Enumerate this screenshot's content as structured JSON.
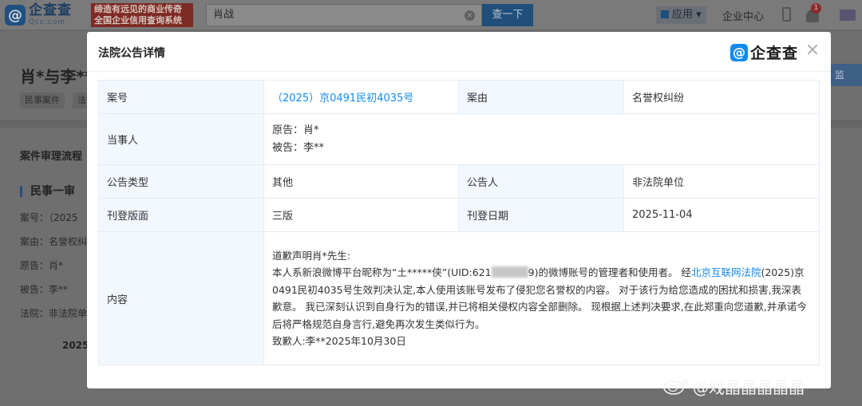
{
  "topbar": {
    "logo_mark": "@",
    "logo_cn": "企查查",
    "logo_en": "Qcc.com",
    "slogan_line1": "缔造有远见的商业传奇",
    "slogan_line2": "全国企业信用查询系统",
    "search_value": "肖战",
    "search_button": "查一下",
    "app_menu": "应用",
    "enterprise_center": "企业中心",
    "notification_count": "1"
  },
  "background": {
    "title": "肖*与李**",
    "tags": [
      "民事案件",
      "法"
    ],
    "monitor_label": "监",
    "section_title": "案件审理流程",
    "sub_title": "民事一审",
    "lines": [
      "案号：（2025",
      "案由：名誉权纠",
      "原告：肖*",
      "被告：李**",
      "法院：非法院单"
    ],
    "year": "2025"
  },
  "modal": {
    "title": "法院公告详情",
    "logo_mark": "@",
    "logo_text": "企查查",
    "close": "×",
    "rows": {
      "case_no_label": "案号",
      "case_no_value": "（2025）京0491民初4035号",
      "cause_label": "案由",
      "cause_value": "名誉权纠纷",
      "parties_label": "当事人",
      "plaintiff": "原告：肖*",
      "defendant": "被告：李**",
      "type_label": "公告类型",
      "type_value": "其他",
      "announcer_label": "公告人",
      "announcer_value": "非法院单位",
      "page_label": "刊登版面",
      "page_value": "三版",
      "date_label": "刊登日期",
      "date_value": "2025-11-04",
      "content_label": "内容"
    },
    "content": {
      "line1": "道歉声明肖*先生:",
      "line2_a": "本人系新浪微博平台昵称为“土*****侠”(UID:621",
      "line2_b": "9)的微博账号的管理者和使用者。 经",
      "court_link": "北京互联网法院",
      "line2_c": "(2025)京0491民初4035号生效判决认定,本人使用该账号发布了侵犯您名誉权的内容。 对于该行为给您造成的困扰和损害,我深表歉意。 我已深刻认识到自身行为的错误,并已将相关侵权内容全部删除。 现根据上述判决要求,在此郑重向您道歉,并承诺今后将严格规范自身言行,避免再次发生类似行为。",
      "signature": "致歉人:李**2025年10月30日"
    }
  },
  "watermark": {
    "text": "@戏晶晶晶晶晶"
  }
}
